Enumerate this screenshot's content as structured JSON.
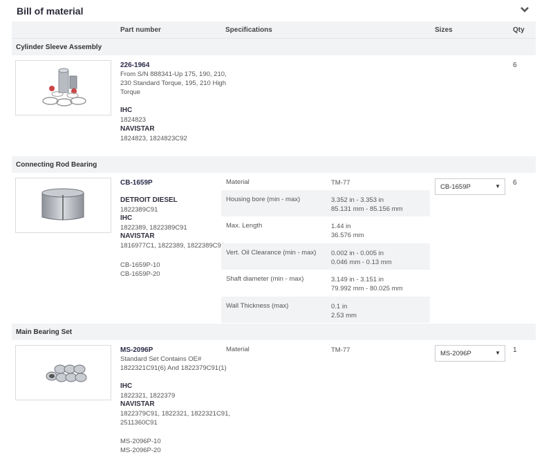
{
  "header": {
    "title": "Bill of material"
  },
  "columns": {
    "part_number": "Part number",
    "specifications": "Specifications",
    "sizes": "Sizes",
    "qty": "Qty"
  },
  "sections": [
    {
      "title": "Cylinder Sleeve Assembly",
      "part_number": "226-1964",
      "desc_lines": [
        "From S/N 888341-Up 175, 190, 210,",
        "230 Standard Torque, 195, 210 High",
        "Torque"
      ],
      "refs": [
        {
          "brand": "IHC",
          "numbers": "1824823"
        },
        {
          "brand": "NAVISTAR",
          "numbers": "1824823, 1824823C92"
        }
      ],
      "qty": "6"
    },
    {
      "title": "Connecting Rod Bearing",
      "part_number": "CB-1659P",
      "refs": [
        {
          "brand": "DETROIT DIESEL",
          "numbers": "1822389C91"
        },
        {
          "brand": "IHC",
          "numbers": "1822389, 1822389C91"
        },
        {
          "brand": "NAVISTAR",
          "numbers": "1816977C1, 1822389, 1822389C91"
        }
      ],
      "variants": [
        "CB-1659P-10",
        "CB-1659P-20"
      ],
      "specs": [
        {
          "label": "Material",
          "value": [
            "TM-77"
          ]
        },
        {
          "label": "Housing bore (min - max)",
          "value": [
            "3.352 in - 3.353 in",
            "85.131 mm - 85.156 mm"
          ]
        },
        {
          "label": "Max. Length",
          "value": [
            "1.44 in",
            "36.576 mm"
          ]
        },
        {
          "label": "Vert. Oil Clearance (min - max)",
          "value": [
            "0.002 in - 0.005 in",
            "0.046 mm - 0.13 mm"
          ]
        },
        {
          "label": "Shaft diameter (min - max)",
          "value": [
            "3.149 in - 3.151 in",
            "79.992 mm - 80.025 mm"
          ]
        },
        {
          "label": "Wall Thickness (max)",
          "value": [
            "0.1 in",
            "2.53 mm"
          ]
        }
      ],
      "size_selected": "CB-1659P",
      "qty": "6"
    },
    {
      "title": "Main Bearing Set",
      "part_number": "MS-2096P",
      "desc_lines": [
        "Standard Set Contains OE#",
        "1822321C91(6) And 1822379C91(1)"
      ],
      "refs": [
        {
          "brand": "IHC",
          "numbers": "1822321, 1822379"
        },
        {
          "brand": "NAVISTAR",
          "numbers": "1822379C91, 1822321, 1822321C91,",
          "numbers2": "2511360C91"
        }
      ],
      "variants": [
        "MS-2096P-10",
        "MS-2096P-20"
      ],
      "specs": [
        {
          "label": "Material",
          "value": [
            "TM-77"
          ]
        }
      ],
      "size_selected": "MS-2096P",
      "qty": "1"
    }
  ],
  "icons": {
    "collapse": "chevron-down-icon",
    "select_arrow": "caret-down-icon"
  }
}
